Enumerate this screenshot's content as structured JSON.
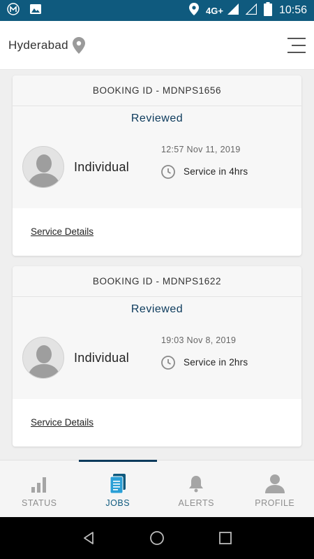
{
  "status_bar": {
    "network": "4G+",
    "time": "10:56",
    "icons": [
      "app-m-icon",
      "image-icon",
      "location-icon",
      "signal-icon",
      "signal-empty-icon",
      "battery-icon"
    ]
  },
  "header": {
    "city": "Hyderabad",
    "icons": [
      "location-pin-icon",
      "hamburger-menu-icon"
    ]
  },
  "bookings": [
    {
      "booking_id": "BOOKING ID - MDNPS1656",
      "status": "Reviewed",
      "customer_type": "Individual",
      "timestamp": "12:57 Nov 11, 2019",
      "service_eta": "Service in 4hrs",
      "details_link": "Service Details"
    },
    {
      "booking_id": "BOOKING ID - MDNPS1622",
      "status": "Reviewed",
      "customer_type": "Individual",
      "timestamp": "19:03 Nov 8, 2019",
      "service_eta": "Service in 2hrs",
      "details_link": "Service Details"
    }
  ],
  "bottom_nav": {
    "active": "JOBS",
    "items": [
      {
        "label": "STATUS",
        "icon": "bar-chart-icon"
      },
      {
        "label": "JOBS",
        "icon": "document-icon"
      },
      {
        "label": "ALERTS",
        "icon": "bell-icon"
      },
      {
        "label": "PROFILE",
        "icon": "person-icon"
      }
    ]
  },
  "colors": {
    "status_bar": "#0f5a7e",
    "accent": "#0c3a5c",
    "active_tab": "#0f5a7e",
    "inactive": "#8e8e8e"
  }
}
